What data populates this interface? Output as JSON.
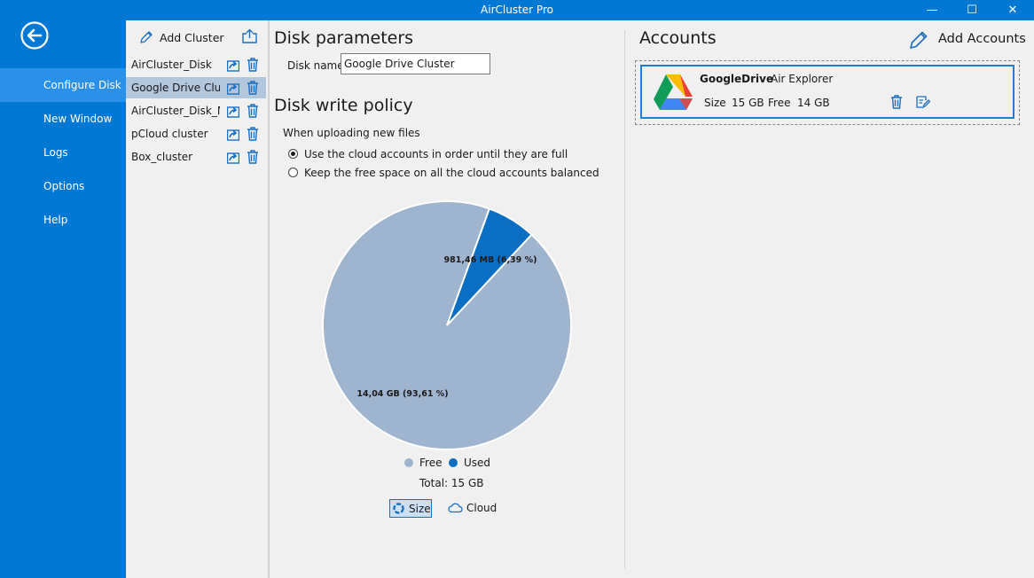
{
  "window": {
    "title": "AirCluster Pro"
  },
  "sidebar": {
    "items": [
      {
        "label": "Configure Disk",
        "selected": true
      },
      {
        "label": "New Window"
      },
      {
        "label": "Logs"
      },
      {
        "label": "Options"
      },
      {
        "label": "Help"
      }
    ]
  },
  "clusters": {
    "add_label": "Add Cluster",
    "items": [
      {
        "name": "AirCluster_Disk"
      },
      {
        "name": "Google Drive Cluster",
        "selected": true
      },
      {
        "name": "AirCluster_Disk_Mirror"
      },
      {
        "name": "pCloud cluster"
      },
      {
        "name": "Box_cluster"
      }
    ]
  },
  "disk_parameters": {
    "heading": "Disk parameters",
    "name_label": "Disk name",
    "name_value": "Google Drive Cluster"
  },
  "write_policy": {
    "heading": "Disk write policy",
    "subheading": "When uploading new files",
    "options": [
      {
        "label": "Use the cloud accounts in order until they are full",
        "selected": true
      },
      {
        "label": "Keep the free space on all the cloud accounts balanced",
        "selected": false
      }
    ]
  },
  "chart_data": {
    "type": "pie",
    "slices": [
      {
        "name": "Free",
        "label": "14,04 GB (93,61 %)",
        "percent": 93.61,
        "color": "#9fb4cf"
      },
      {
        "name": "Used",
        "label": "981,46 MB (6,39 %)",
        "percent": 6.39,
        "color": "#0a6fc2"
      }
    ],
    "total": "Total: 15 GB",
    "legend": "bottom"
  },
  "view_toggle": {
    "size_label": "Size",
    "cloud_label": "Cloud",
    "selected": "Size"
  },
  "accounts": {
    "heading": "Accounts",
    "add_label": "Add Accounts",
    "items": [
      {
        "name": "GoogleDrive",
        "app": "Air Explorer",
        "size_label": "Size",
        "size": "15 GB",
        "free_label": "Free",
        "free": "14 GB",
        "icon": "google-drive-icon"
      }
    ]
  },
  "colors": {
    "accent": "#0078d4",
    "used": "#0a6fc2",
    "free": "#9fb4cf"
  }
}
